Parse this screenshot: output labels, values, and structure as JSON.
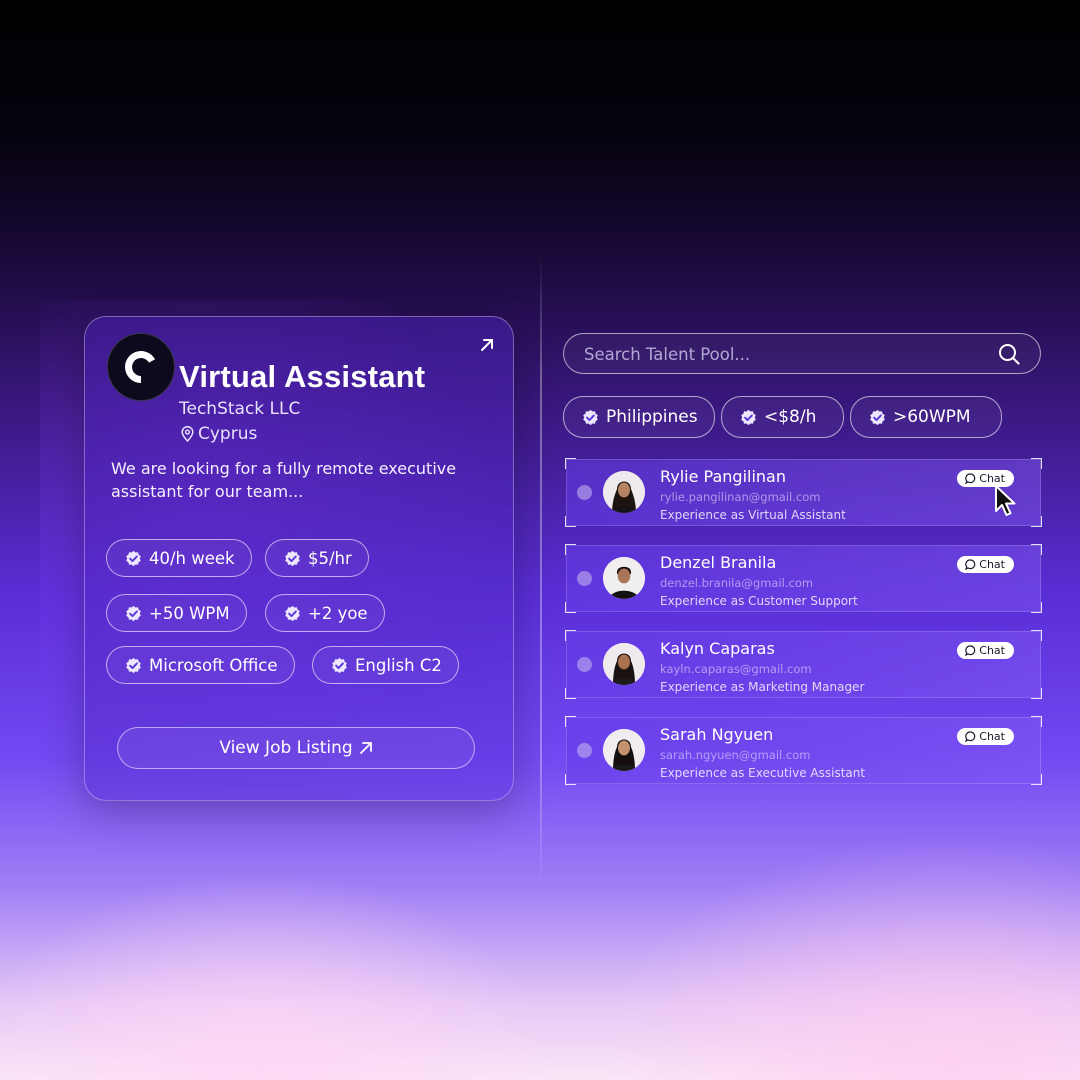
{
  "job": {
    "title": "Virtual Assistant",
    "company": "TechStack LLC",
    "location": "Cyprus",
    "description": "We are looking for a fully remote executive assistant for our team...",
    "tags": [
      "40/h week",
      "$5/hr",
      "+50 WPM",
      "+2 yoe",
      "Microsoft Office",
      "English C2"
    ],
    "cta_label": "View Job Listing"
  },
  "search": {
    "placeholder": "Search Talent Pool..."
  },
  "filters": [
    "Philippines",
    "<$8/h",
    ">60WPM"
  ],
  "chat_label": "Chat",
  "candidates": [
    {
      "name": "Rylie Pangilinan",
      "email": "rylie.pangilinan@gmail.com",
      "experience": "Experience as Virtual Assistant"
    },
    {
      "name": "Denzel Branila",
      "email": "denzel.branila@gmail.com",
      "experience": "Experience as Customer Support"
    },
    {
      "name": "Kalyn Caparas",
      "email": "kayln.caparas@gmail.com",
      "experience": "Experience as Marketing Manager"
    },
    {
      "name": "Sarah Ngyuen",
      "email": "sarah.ngyuen@gmail.com",
      "experience": "Experience as Executive Assistant"
    }
  ],
  "colors": {
    "accent": "#6a3df0",
    "tag_border": "#ffffff",
    "chat_bg": "#ffffff"
  },
  "icons": {
    "logo": "c-logo-icon",
    "open": "arrow-up-right-icon",
    "location": "map-pin-icon",
    "verified": "verified-badge-icon",
    "search": "search-icon",
    "chat": "chat-bubble-icon",
    "cursor": "mouse-pointer-icon"
  }
}
